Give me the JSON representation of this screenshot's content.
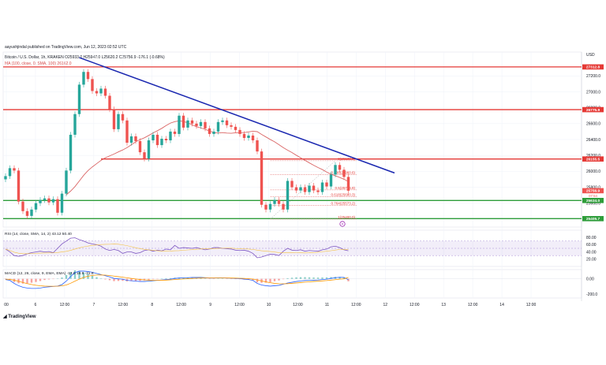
{
  "header": {
    "top": "aayushjindal published on TradingView.com, Jun 12, 2023 02:52 UTC",
    "ohlc": "Bitcoin / U.S. Dollar, 1h, KRAKEN  O25933.0  H25947.0  L25620.2  C25756.9  -176.1 (-0.68%)",
    "ma": "MA (100, close, 0, SMA, 100)  26162.0"
  },
  "brand": "TradingView",
  "colors": {
    "up": "#26a69a",
    "down": "#ef5350",
    "trendline": "#1a27b0",
    "resistance": "#e53935",
    "support": "#2e9d3a",
    "ma": "#d44a4a",
    "rsi": "#7e57c2",
    "macd_line": "#2962ff",
    "macd_signal": "#ff9800"
  },
  "chart_data": [
    {
      "type": "candlestick",
      "currency_label": "USD",
      "ylim": [
        25300,
        27500
      ],
      "ytick_labels": [
        "27200.0",
        "27000.0",
        "26800.0",
        "26600.0",
        "26400.0",
        "26200.0",
        "26000.0",
        "25800.0",
        "25600.0",
        "25400.0"
      ],
      "x_labels": [
        "00",
        "6",
        "12:00",
        "7",
        "12:00",
        "8",
        "12:00",
        "9",
        "12:00",
        "10",
        "12:00",
        "11",
        "12:00",
        "12",
        "12:00",
        "13",
        "12:00",
        "14",
        "12:00"
      ],
      "price_tags": [
        {
          "value": 27312.8,
          "label": "27312.8",
          "color": "#e53935"
        },
        {
          "value": 26775.9,
          "label": "26775.9",
          "color": "#e53935"
        },
        {
          "value": 26155.5,
          "label": "26155.5",
          "color": "#e53935"
        },
        {
          "value": 25756.9,
          "label": "25756.9",
          "color": "#ef5350"
        },
        {
          "value": 25634.0,
          "label": "25634.0",
          "color": "#2e9d3a"
        },
        {
          "value": 25405.7,
          "label": "25405.7",
          "color": "#2e9d3a"
        }
      ],
      "countdown": "07:54",
      "horizontal_levels": [
        {
          "value": 27312.8,
          "role": "resistance"
        },
        {
          "value": 26775.9,
          "role": "resistance"
        },
        {
          "value": 26155.5,
          "role": "resistance"
        },
        {
          "value": 25634.0,
          "role": "support"
        },
        {
          "value": 25405.7,
          "role": "support"
        }
      ],
      "trendline": {
        "from_index": 17,
        "from_value": 27430,
        "to_index": 86,
        "to_value": 25980
      },
      "ma_value": 26162.0,
      "fib_levels": [
        {
          "label": "0(26133.8)",
          "value": 26133.8
        },
        {
          "label": "0.236(25960.6)",
          "value": 25960.6
        },
        {
          "label": "0.5(25766.9)",
          "value": 25766.9
        },
        {
          "label": "0.618(25680.3)",
          "value": 25680.3
        },
        {
          "label": "0.764(25573.2)",
          "value": 25573.2
        },
        {
          "label": "1(25400.0)",
          "value": 25400.0
        },
        {
          "label": "1.236(25226.8)",
          "value": 25226.8
        }
      ],
      "fib_index_range": [
        61,
        78
      ],
      "candles": [
        25940,
        26040,
        26010,
        25620,
        25500,
        25440,
        25520,
        25600,
        25640,
        25660,
        25610,
        25650,
        25480,
        25720,
        26010,
        26460,
        26720,
        27090,
        27250,
        27160,
        27010,
        26980,
        27040,
        26950,
        26780,
        26530,
        26720,
        26640,
        26360,
        26440,
        26380,
        26240,
        26160,
        26390,
        26460,
        26330,
        26410,
        26390,
        26500,
        26470,
        26700,
        26550,
        26640,
        26600,
        26570,
        26620,
        26540,
        26470,
        26500,
        26620,
        26640,
        26580,
        26560,
        26520,
        26470,
        26420,
        26450,
        26390,
        26250,
        25580,
        25520,
        25590,
        25640,
        25590,
        25520,
        25880,
        25800,
        25760,
        25800,
        25740,
        25820,
        25760,
        25740,
        25860,
        25810,
        25960,
        26080,
        26020,
        25930,
        25756.9
      ]
    },
    {
      "type": "line",
      "header": "RSI (14, close, SMA, 14, 2)  43.12  50.40",
      "ytick_labels": [
        "80.00",
        "60.00",
        "40.00",
        "20.00"
      ],
      "ylim": [
        0,
        100
      ],
      "band": [
        30,
        70
      ],
      "values": [
        48,
        40,
        30,
        28,
        30,
        35,
        38,
        40,
        42,
        40,
        41,
        38,
        50,
        62,
        70,
        78,
        79,
        74,
        70,
        65,
        62,
        60,
        56,
        48,
        44,
        47,
        44,
        36,
        40,
        40,
        36,
        38,
        44,
        46,
        42,
        45,
        43,
        48,
        46,
        58,
        50,
        52,
        51,
        50,
        52,
        49,
        46,
        48,
        52,
        52,
        50,
        49,
        48,
        45,
        44,
        45,
        42,
        36,
        24,
        26,
        30,
        34,
        33,
        30,
        42,
        50,
        45,
        44,
        46,
        42,
        44,
        43,
        42,
        46,
        48,
        54,
        56,
        52,
        46,
        43.12
      ]
    },
    {
      "type": "line",
      "header": "MACD (12, 26, close, 9, EMA, EMA)  -13.0  18.8  -31.8",
      "ytick_labels": [
        "0.00",
        "-200.0"
      ],
      "ylim": [
        -250,
        120
      ],
      "macd": [
        -10,
        -20,
        -60,
        -90,
        -110,
        -120,
        -125,
        -125,
        -120,
        -110,
        -105,
        -100,
        -95,
        -75,
        -30,
        30,
        80,
        100,
        100,
        95,
        85,
        70,
        55,
        40,
        25,
        5,
        0,
        -5,
        -20,
        -25,
        -30,
        -35,
        -35,
        -30,
        -25,
        -20,
        -15,
        -10,
        -5,
        5,
        10,
        12,
        15,
        18,
        18,
        18,
        15,
        10,
        10,
        12,
        12,
        10,
        8,
        5,
        2,
        -5,
        -10,
        -20,
        -60,
        -80,
        -90,
        -95,
        -90,
        -85,
        -70,
        -55,
        -45,
        -35,
        -28,
        -22,
        -20,
        -18,
        -15,
        -10,
        -5,
        5,
        15,
        20,
        18,
        -13
      ],
      "signal": [
        -5,
        -8,
        -18,
        -32,
        -48,
        -62,
        -74,
        -84,
        -91,
        -95,
        -97,
        -97,
        -96,
        -92,
        -80,
        -58,
        -30,
        -4,
        18,
        34,
        44,
        49,
        50,
        48,
        43,
        35,
        28,
        21,
        13,
        5,
        -2,
        -9,
        -14,
        -17,
        -19,
        -19,
        -18,
        -17,
        -14,
        -10,
        -6,
        -2,
        1,
        5,
        8,
        10,
        11,
        11,
        11,
        11,
        11,
        11,
        10,
        9,
        7,
        5,
        2,
        -3,
        -15,
        -28,
        -40,
        -51,
        -59,
        -64,
        -65,
        -63,
        -59,
        -54,
        -49,
        -43,
        -39,
        -35,
        -31,
        -27,
        -23,
        -17,
        -11,
        -5,
        0,
        18.8
      ]
    }
  ]
}
